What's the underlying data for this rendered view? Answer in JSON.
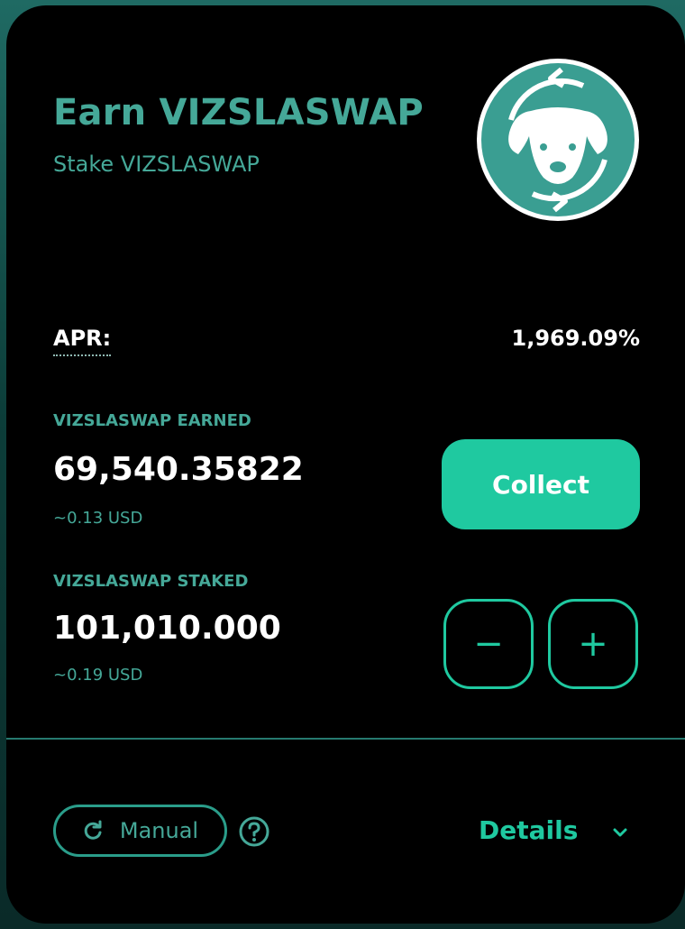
{
  "pool": {
    "title": "Earn VIZSLASWAP",
    "subtitle": "Stake VIZSLASWAP",
    "logo_icon": "vizslaswap-dog-logo"
  },
  "apr": {
    "label": "APR:",
    "value": "1,969.09%"
  },
  "earned": {
    "label": "VIZSLASWAP EARNED",
    "amount": "69,540.35822",
    "usd": "~0.13 USD",
    "collect_label": "Collect"
  },
  "staked": {
    "label": "VIZSLASWAP STAKED",
    "amount": "101,010.000",
    "usd": "~0.19 USD",
    "minus_label": "−",
    "plus_label": "+"
  },
  "footer": {
    "manual_label": "Manual",
    "details_label": "Details"
  },
  "colors": {
    "accent": "#1fc9a0",
    "teal": "#45a898",
    "background": "#000000"
  }
}
